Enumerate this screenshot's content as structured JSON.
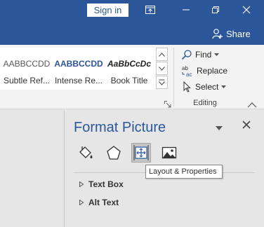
{
  "titlebar": {
    "signin_label": "Sign in",
    "share_label": "Share",
    "color": "#2b579a"
  },
  "ribbon": {
    "styles": [
      {
        "preview": "AABBCCDD",
        "name": "Subtle Ref..."
      },
      {
        "preview": "AABBCCDD",
        "name": "Intense Re..."
      },
      {
        "preview": "AaBbCcDc",
        "name": "Book Title"
      }
    ],
    "editing": {
      "find_label": "Find",
      "replace_label": "Replace",
      "select_label": "Select",
      "group_label": "Editing"
    }
  },
  "pane": {
    "title": "Format Picture",
    "categories": [
      {
        "icon": "fill-line-icon"
      },
      {
        "icon": "effects-icon"
      },
      {
        "icon": "layout-properties-icon",
        "active": true
      },
      {
        "icon": "picture-icon"
      }
    ],
    "tooltip": "Layout & Properties",
    "sections": [
      {
        "label": "Text Box"
      },
      {
        "label": "Alt Text"
      }
    ]
  }
}
